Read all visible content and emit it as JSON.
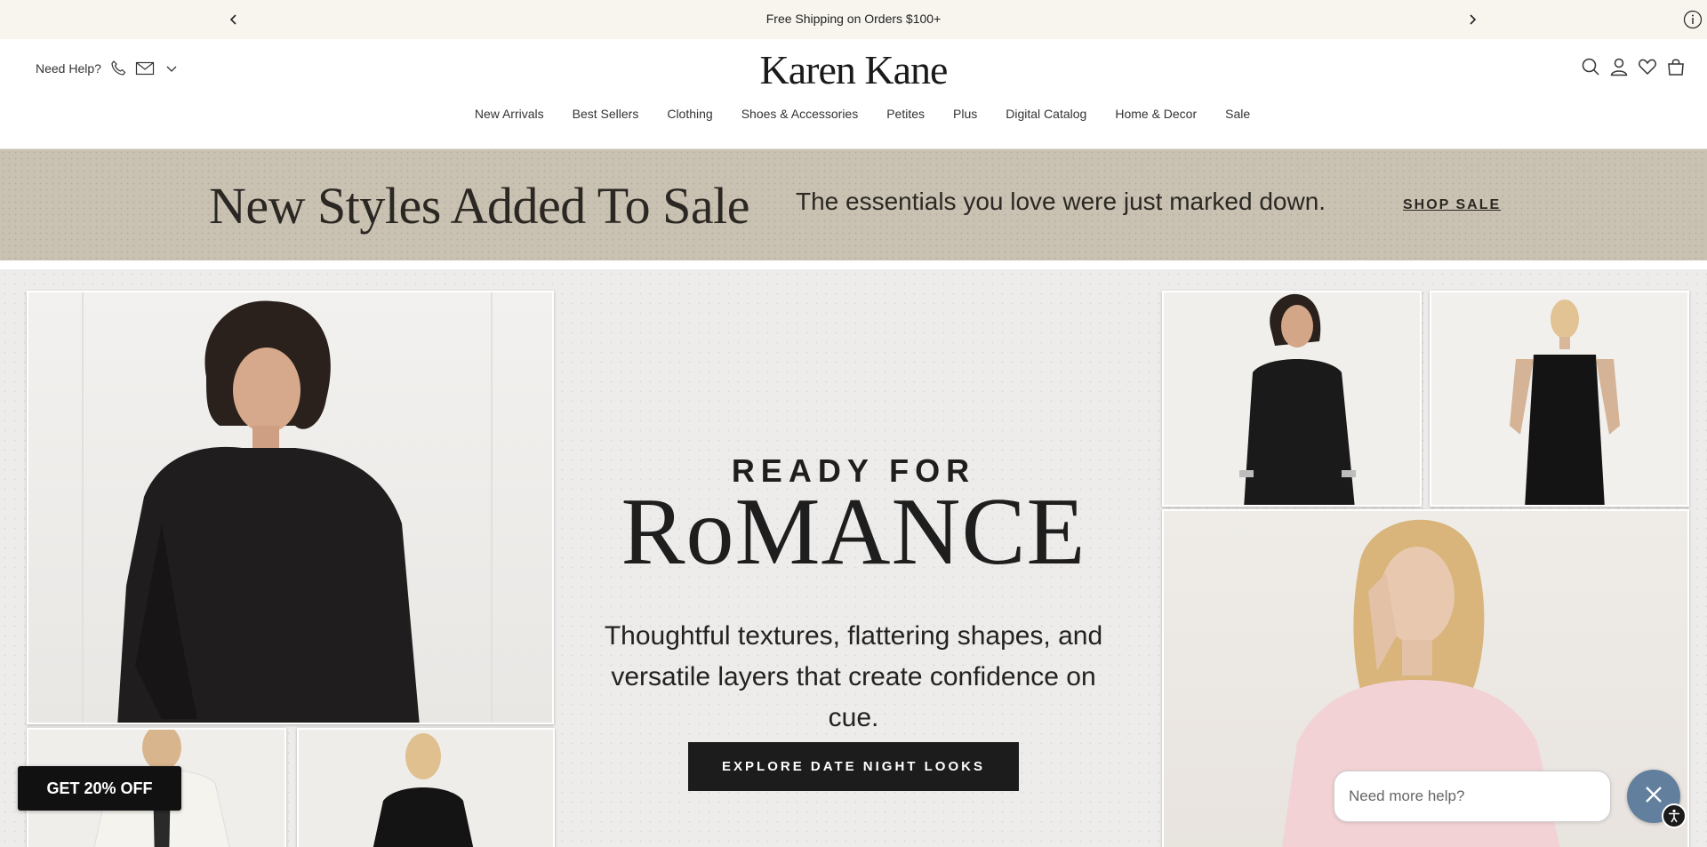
{
  "announcement": {
    "message": "Free Shipping on Orders $100+",
    "prev_icon": "chevron-left-icon",
    "next_icon": "chevron-right-icon",
    "info_icon": "info-icon"
  },
  "header": {
    "help_label": "Need Help?",
    "logo": "Karen Kane",
    "nav": [
      "New Arrivals",
      "Best Sellers",
      "Clothing",
      "Shoes & Accessories",
      "Petites",
      "Plus",
      "Digital Catalog",
      "Home & Decor",
      "Sale"
    ],
    "utility_icons": [
      "search-icon",
      "account-icon",
      "heart-icon",
      "bag-icon"
    ]
  },
  "sale_banner": {
    "title": "New Styles Added To Sale",
    "subtitle": "The essentials you love were just marked down.",
    "cta": "SHOP SALE",
    "background": "#c9c1b2"
  },
  "hero": {
    "eyebrow": "READY FOR",
    "headline": "RoMANCE",
    "description": "Thoughtful textures, flattering shapes, and versatile layers that create confidence on cue.",
    "cta": "EXPLORE DATE NIGHT LOOKS"
  },
  "widgets": {
    "promo": "GET 20% OFF",
    "chat_placeholder": "Need more help?",
    "chat_close_color": "#62809d"
  }
}
